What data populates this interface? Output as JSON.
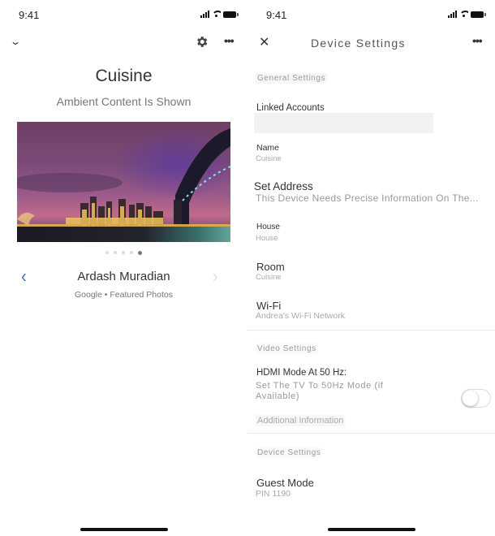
{
  "left_screen": {
    "status_bar": {
      "time": "9:41"
    },
    "toolbar": {
      "collapse_icon": "chevron-down-icon",
      "settings_icon": "gear-icon",
      "more_icon": "more-horizontal-icon",
      "more_label": "•••"
    },
    "device": {
      "title": "Cuisine",
      "subtitle": "Ambient Content Is Shown"
    },
    "photo": {
      "description": "Sydney skyline at dusk with Harbour Bridge and Opera House",
      "pager": {
        "count": 5,
        "active_index": 4
      }
    },
    "credit": {
      "prev_label": "‹",
      "next_label": "›",
      "name": "Ardash Muradian",
      "source": "Google • Featured Photos"
    }
  },
  "right_screen": {
    "status_bar": {
      "time": "9:41"
    },
    "header": {
      "close_label": "✕",
      "title": "Device Settings",
      "more_label": "•••"
    },
    "sections": {
      "general": "General Settings",
      "video": "Video Settings",
      "device": "Device Settings"
    },
    "rows": {
      "linked_accounts": {
        "label": "Linked Accounts"
      },
      "name": {
        "label": "Name",
        "value": "Cuisine"
      },
      "address": {
        "label": "Set Address",
        "value": "This Device Needs Precise Information On The..."
      },
      "house": {
        "label": "House",
        "value": "House"
      },
      "room": {
        "label": "Room",
        "value": "Cuisine"
      },
      "wifi": {
        "label": "Wi-Fi",
        "value": "Andrea's Wi-Fi Network"
      },
      "hdmi": {
        "label": "HDMI Mode At 50 Hz:",
        "description": "Set The TV To 50Hz Mode (if Available)",
        "enabled": false
      },
      "additional_info": {
        "label": "Additional Information"
      },
      "guest_mode": {
        "label": "Guest Mode",
        "value": "PIN 1190"
      }
    }
  }
}
